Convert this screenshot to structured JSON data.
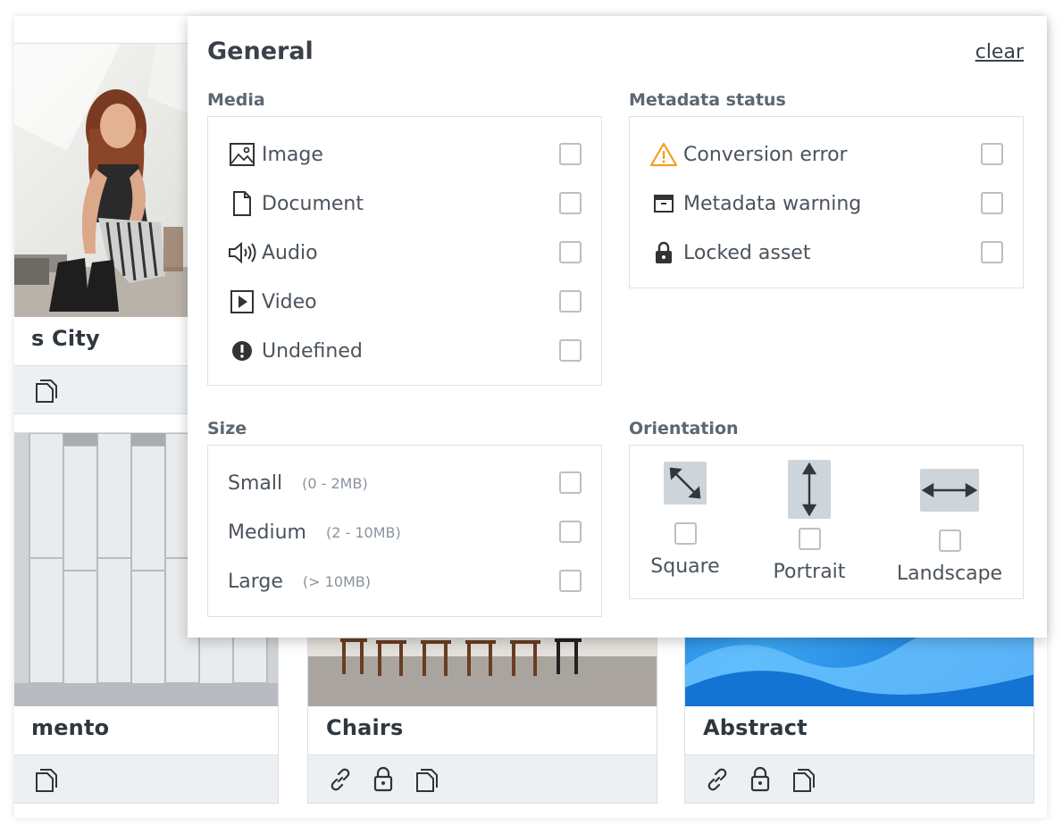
{
  "background_cards": [
    {
      "title": "s City"
    },
    {
      "title": "mento"
    },
    {
      "title": "Chairs"
    },
    {
      "title": "Abstract"
    }
  ],
  "panel": {
    "title": "General",
    "clear_label": "clear",
    "media": {
      "label": "Media",
      "items": [
        {
          "label": "Image",
          "icon": "image-icon"
        },
        {
          "label": "Document",
          "icon": "document-icon"
        },
        {
          "label": "Audio",
          "icon": "audio-icon"
        },
        {
          "label": "Video",
          "icon": "video-icon"
        },
        {
          "label": "Undefined",
          "icon": "exclamation-icon"
        }
      ]
    },
    "metadata": {
      "label": "Metadata status",
      "items": [
        {
          "label": "Conversion error",
          "icon": "warning-icon"
        },
        {
          "label": "Metadata warning",
          "icon": "archive-icon"
        },
        {
          "label": "Locked asset",
          "icon": "lock-icon"
        }
      ]
    },
    "size": {
      "label": "Size",
      "items": [
        {
          "label": "Small",
          "range": "(0 - 2MB)"
        },
        {
          "label": "Medium",
          "range": "(2 - 10MB)"
        },
        {
          "label": "Large",
          "range": "(> 10MB)"
        }
      ]
    },
    "orientation": {
      "label": "Orientation",
      "items": [
        {
          "label": "Square",
          "icon": "diagonal-arrow-icon"
        },
        {
          "label": "Portrait",
          "icon": "vertical-arrow-icon"
        },
        {
          "label": "Landscape",
          "icon": "horizontal-arrow-icon"
        }
      ]
    }
  },
  "colors": {
    "warning": "#f0a020",
    "panel_bg": "#ffffff",
    "bar_bg": "#edf0f3",
    "orient_icon_bg": "#cdd4da"
  }
}
